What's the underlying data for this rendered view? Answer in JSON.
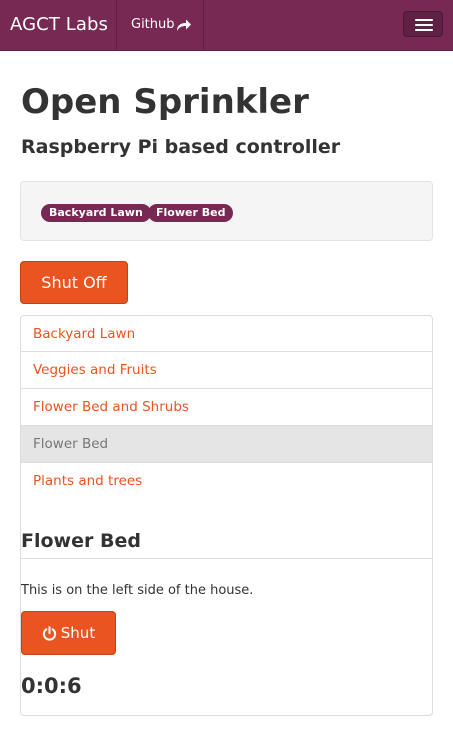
{
  "navbar": {
    "brand": "AGCT Labs",
    "links": [
      {
        "label": "Github",
        "icon": "share-arrow-icon"
      }
    ],
    "toggle_icon": "hamburger-icon",
    "colors": {
      "background": "#772953",
      "text": "#ffffff"
    }
  },
  "header": {
    "title": "Open Sprinkler",
    "subtitle": "Raspberry Pi based controller"
  },
  "active_zones": {
    "badges": [
      "Backyard Lawn",
      "Flower Bed"
    ]
  },
  "controls": {
    "shut_off_label": "Shut Off"
  },
  "zones": [
    {
      "label": "Backyard Lawn",
      "active": false
    },
    {
      "label": "Veggies and Fruits",
      "active": false
    },
    {
      "label": "Flower Bed and Shrubs",
      "active": false
    },
    {
      "label": "Flower Bed",
      "active": true
    },
    {
      "label": "Plants and trees",
      "active": false
    }
  ],
  "detail": {
    "title": "Flower Bed",
    "description": "This is on the left side of the house.",
    "button_label": "Shut",
    "button_icon": "power-icon",
    "timer": "0:0:6"
  },
  "colors": {
    "accent": "#e95420",
    "brand": "#772953",
    "active_item_bg": "#e5e5e5"
  }
}
